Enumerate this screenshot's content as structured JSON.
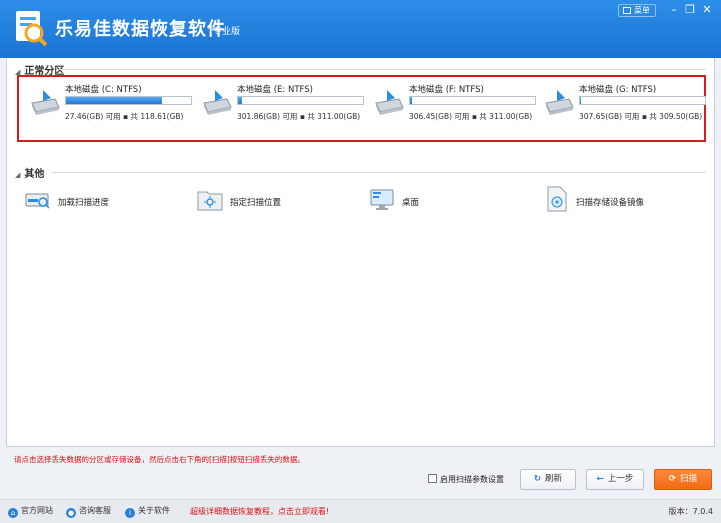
{
  "app": {
    "title": "乐易佳数据恢复软件",
    "edition": "专业版",
    "menu_label": "菜单"
  },
  "sections": {
    "partitions_title": "正常分区",
    "other_title": "其他"
  },
  "drives": [
    {
      "name": "本地磁盘 (C: NTFS)",
      "info": "27.46(GB) 可用 ▪ 共 118.61(GB)",
      "used_fraction": 0.77
    },
    {
      "name": "本地磁盘 (E: NTFS)",
      "info": "301.86(GB) 可用 ▪ 共 311.00(GB)",
      "used_fraction": 0.03
    },
    {
      "name": "本地磁盘 (F: NTFS)",
      "info": "306.45(GB) 可用 ▪ 共 311.00(GB)",
      "used_fraction": 0.015
    },
    {
      "name": "本地磁盘 (G: NTFS)",
      "info": "307.65(GB) 可用 ▪ 共 309.50(GB)",
      "used_fraction": 0.006
    }
  ],
  "other_items": [
    {
      "label": "加载扫描进度",
      "icon": "load-progress-icon"
    },
    {
      "label": "指定扫描位置",
      "icon": "folder-target-icon"
    },
    {
      "label": "桌面",
      "icon": "desktop-icon"
    },
    {
      "label": "扫描存储设备镜像",
      "icon": "disk-image-icon"
    }
  ],
  "hint": "请点击选择丢失数据的分区或存储设备，然后点击右下角的[扫描]按钮扫描丢失的数据。",
  "footer": {
    "checkbox_label": "启用扫描参数设置",
    "refresh_label": "刷新",
    "back_label": "上一步",
    "scan_label": "扫描"
  },
  "status": {
    "website": "官方网站",
    "support": "咨询客服",
    "about": "关于软件",
    "promo": "超级详细数据恢复教程，点击立即观看!",
    "version": "版本：7.0.4"
  },
  "colors": {
    "titlebar": "#1a73d3",
    "highlight_border": "#d81c1c",
    "primary_button": "#f06a12"
  }
}
